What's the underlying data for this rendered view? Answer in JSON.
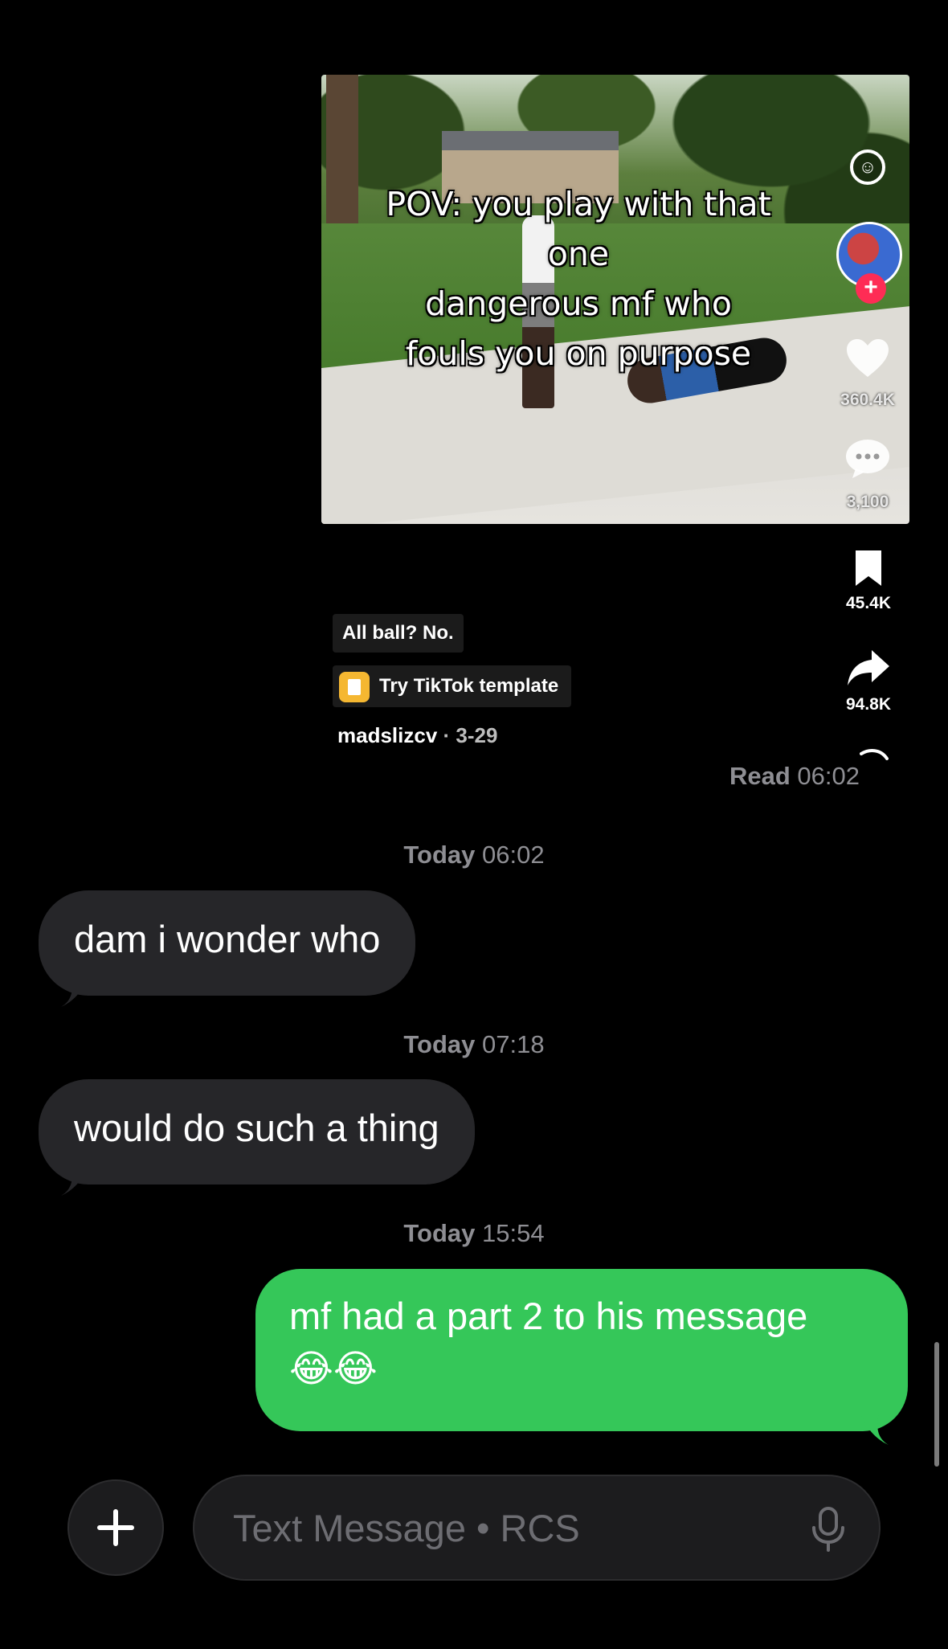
{
  "tiktok": {
    "caption_lines": [
      "POV: you play with that one",
      "dangerous mf who",
      "fouls you on purpose"
    ],
    "likes": "360.4K",
    "comments": "3,100",
    "saves": "45.4K",
    "shares": "94.8K",
    "sound_label": "All ball? No.",
    "template_label": "Try TikTok template",
    "username": "madslizcv",
    "date": "· 3-29"
  },
  "read_receipt": {
    "label": "Read",
    "time": "06:02"
  },
  "thread": [
    {
      "type": "timestamp",
      "day": "Today",
      "time": "06:02"
    },
    {
      "type": "incoming",
      "text": "dam i wonder who"
    },
    {
      "type": "timestamp",
      "day": "Today",
      "time": "07:18"
    },
    {
      "type": "incoming",
      "text": "would do such a thing"
    },
    {
      "type": "timestamp",
      "day": "Today",
      "time": "15:54"
    },
    {
      "type": "outgoing",
      "text": "mf had a part 2 to his message",
      "emoji": "😂😂"
    }
  ],
  "composer": {
    "placeholder": "Text Message • RCS",
    "plus_icon": "plus-icon",
    "mic_icon": "microphone-icon"
  },
  "colors": {
    "incoming_bubble": "#262629",
    "outgoing_bubble": "#35c759",
    "timestamp_text": "#8e8e93",
    "tiktok_follow": "#fe2c55"
  }
}
